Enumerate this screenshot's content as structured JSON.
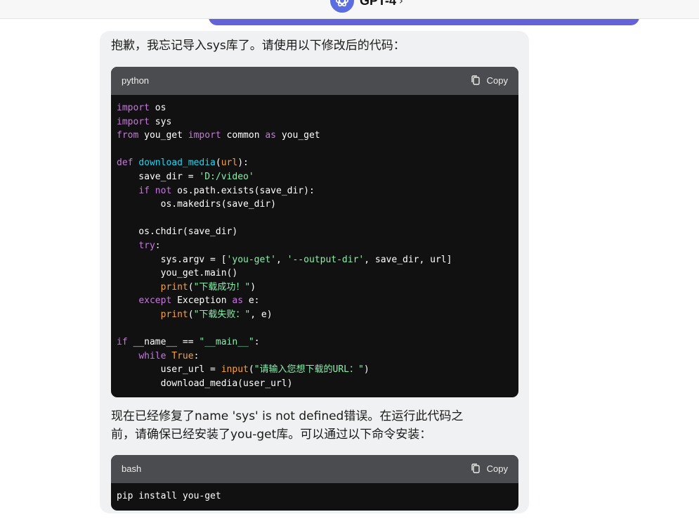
{
  "header": {
    "model_label": "GPT-4",
    "chevron": "›"
  },
  "message": {
    "intro": "抱歉，我忘记导入sys库了。请使用以下修改后的代码：",
    "middle_line1": "现在已经修复了name 'sys' is not defined错误。在运行此代码之",
    "middle_line2": "前，请确保已经安装了you-get库。可以通过以下命令安装：",
    "code_blocks": [
      {
        "lang": "python",
        "copy_label": "Copy",
        "lines": [
          [
            {
              "t": "import",
              "c": "kw"
            },
            {
              "t": " os"
            }
          ],
          [
            {
              "t": "import",
              "c": "kw"
            },
            {
              "t": " sys"
            }
          ],
          [
            {
              "t": "from",
              "c": "kw"
            },
            {
              "t": " you_get "
            },
            {
              "t": "import",
              "c": "kw"
            },
            {
              "t": " common "
            },
            {
              "t": "as",
              "c": "kw"
            },
            {
              "t": " you_get"
            }
          ],
          [],
          [
            {
              "t": "def",
              "c": "kw"
            },
            {
              "t": " "
            },
            {
              "t": "download_media",
              "c": "fn"
            },
            {
              "t": "("
            },
            {
              "t": "url",
              "c": "pm"
            },
            {
              "t": "):"
            }
          ],
          [
            {
              "t": "    save_dir = "
            },
            {
              "t": "'D:/video'",
              "c": "st"
            }
          ],
          [
            {
              "t": "    "
            },
            {
              "t": "if",
              "c": "kw"
            },
            {
              "t": " "
            },
            {
              "t": "not",
              "c": "kw"
            },
            {
              "t": " os.path.exists(save_dir):"
            }
          ],
          [
            {
              "t": "        os.makedirs(save_dir)"
            }
          ],
          [],
          [
            {
              "t": "    os.chdir(save_dir)"
            }
          ],
          [
            {
              "t": "    "
            },
            {
              "t": "try",
              "c": "kw"
            },
            {
              "t": ":"
            }
          ],
          [
            {
              "t": "        sys.argv = ["
            },
            {
              "t": "'you-get'",
              "c": "st"
            },
            {
              "t": ", "
            },
            {
              "t": "'--output-dir'",
              "c": "st"
            },
            {
              "t": ", save_dir, url]"
            }
          ],
          [
            {
              "t": "        you_get.main()"
            }
          ],
          [
            {
              "t": "        "
            },
            {
              "t": "print",
              "c": "bi"
            },
            {
              "t": "("
            },
            {
              "t": "\"下载成功！\"",
              "c": "st"
            },
            {
              "t": ")"
            }
          ],
          [
            {
              "t": "    "
            },
            {
              "t": "except",
              "c": "kw"
            },
            {
              "t": " Exception "
            },
            {
              "t": "as",
              "c": "kw"
            },
            {
              "t": " e:"
            }
          ],
          [
            {
              "t": "        "
            },
            {
              "t": "print",
              "c": "bi"
            },
            {
              "t": "("
            },
            {
              "t": "\"下载失败：\"",
              "c": "st"
            },
            {
              "t": ", e)"
            }
          ],
          [],
          [
            {
              "t": "if",
              "c": "kw"
            },
            {
              "t": " __name__ == "
            },
            {
              "t": "\"__main__\"",
              "c": "st"
            },
            {
              "t": ":"
            }
          ],
          [
            {
              "t": "    "
            },
            {
              "t": "while",
              "c": "kw"
            },
            {
              "t": " "
            },
            {
              "t": "True",
              "c": "tr"
            },
            {
              "t": ":"
            }
          ],
          [
            {
              "t": "        user_url = "
            },
            {
              "t": "input",
              "c": "bi"
            },
            {
              "t": "("
            },
            {
              "t": "\"请输入您想下载的URL：\"",
              "c": "st"
            },
            {
              "t": ")"
            }
          ],
          [
            {
              "t": "        download_media(user_url)"
            }
          ]
        ]
      },
      {
        "lang": "bash",
        "copy_label": "Copy",
        "lines": [
          [
            {
              "t": "pip install you-get"
            }
          ]
        ]
      }
    ]
  },
  "icons": {
    "model": "openai-logo-icon",
    "copy": "clipboard-icon"
  },
  "colors": {
    "accent_bar": "#6362d8",
    "bubble_bg": "#f0f1f2",
    "code_bg": "#111111",
    "code_header_bg": "#4b4c4f",
    "keyword": "#c678dd",
    "function": "#22d3ee",
    "string": "#86efac",
    "builtin": "#f5a142"
  }
}
